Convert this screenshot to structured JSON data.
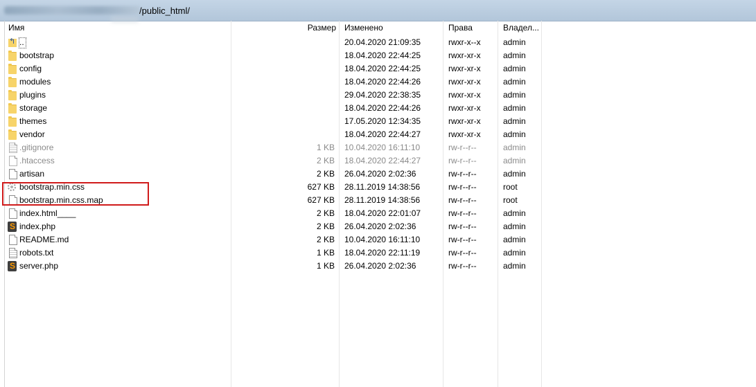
{
  "path": {
    "suffix": "/public_html/"
  },
  "columns": {
    "name": "Имя",
    "size": "Размер",
    "modified": "Изменено",
    "permissions": "Права",
    "owner": "Владел..."
  },
  "files": [
    {
      "name": "..",
      "icon": "parent-folder-icon",
      "size": "",
      "modified": "20.04.2020 21:09:35",
      "permissions": "rwxr-x--x",
      "owner": "admin",
      "dim": false
    },
    {
      "name": "bootstrap",
      "icon": "folder-icon",
      "size": "",
      "modified": "18.04.2020 22:44:25",
      "permissions": "rwxr-xr-x",
      "owner": "admin",
      "dim": false
    },
    {
      "name": "config",
      "icon": "folder-icon",
      "size": "",
      "modified": "18.04.2020 22:44:25",
      "permissions": "rwxr-xr-x",
      "owner": "admin",
      "dim": false
    },
    {
      "name": "modules",
      "icon": "folder-icon",
      "size": "",
      "modified": "18.04.2020 22:44:26",
      "permissions": "rwxr-xr-x",
      "owner": "admin",
      "dim": false
    },
    {
      "name": "plugins",
      "icon": "folder-icon",
      "size": "",
      "modified": "29.04.2020 22:38:35",
      "permissions": "rwxr-xr-x",
      "owner": "admin",
      "dim": false
    },
    {
      "name": "storage",
      "icon": "folder-icon",
      "size": "",
      "modified": "18.04.2020 22:44:26",
      "permissions": "rwxr-xr-x",
      "owner": "admin",
      "dim": false
    },
    {
      "name": "themes",
      "icon": "folder-icon",
      "size": "",
      "modified": "17.05.2020 12:34:35",
      "permissions": "rwxr-xr-x",
      "owner": "admin",
      "dim": false
    },
    {
      "name": "vendor",
      "icon": "folder-icon",
      "size": "",
      "modified": "18.04.2020 22:44:27",
      "permissions": "rwxr-xr-x",
      "owner": "admin",
      "dim": false
    },
    {
      "name": ".gitignore",
      "icon": "text-file-icon",
      "size": "1 KB",
      "modified": "10.04.2020 16:11:10",
      "permissions": "rw-r--r--",
      "owner": "admin",
      "dim": true
    },
    {
      "name": ".htaccess",
      "icon": "file-icon",
      "size": "2 KB",
      "modified": "18.04.2020 22:44:27",
      "permissions": "rw-r--r--",
      "owner": "admin",
      "dim": true
    },
    {
      "name": "artisan",
      "icon": "file-icon",
      "size": "2 KB",
      "modified": "26.04.2020 2:02:36",
      "permissions": "rw-r--r--",
      "owner": "admin",
      "dim": false
    },
    {
      "name": "bootstrap.min.css",
      "icon": "gear-file-icon",
      "size": "627 KB",
      "modified": "28.11.2019 14:38:56",
      "permissions": "rw-r--r--",
      "owner": "root",
      "dim": false
    },
    {
      "name": "bootstrap.min.css.map",
      "icon": "file-icon",
      "size": "627 KB",
      "modified": "28.11.2019 14:38:56",
      "permissions": "rw-r--r--",
      "owner": "root",
      "dim": false
    },
    {
      "name": "index.html____",
      "icon": "file-icon",
      "size": "2 KB",
      "modified": "18.04.2020 22:01:07",
      "permissions": "rw-r--r--",
      "owner": "admin",
      "dim": false
    },
    {
      "name": "index.php",
      "icon": "sublime-icon",
      "size": "2 KB",
      "modified": "26.04.2020 2:02:36",
      "permissions": "rw-r--r--",
      "owner": "admin",
      "dim": false
    },
    {
      "name": "README.md",
      "icon": "file-icon",
      "size": "2 KB",
      "modified": "10.04.2020 16:11:10",
      "permissions": "rw-r--r--",
      "owner": "admin",
      "dim": false
    },
    {
      "name": "robots.txt",
      "icon": "text-file-icon",
      "size": "1 KB",
      "modified": "18.04.2020 22:11:19",
      "permissions": "rw-r--r--",
      "owner": "admin",
      "dim": false
    },
    {
      "name": "server.php",
      "icon": "sublime-icon",
      "size": "1 KB",
      "modified": "26.04.2020 2:02:36",
      "permissions": "rw-r--r--",
      "owner": "admin",
      "dim": false
    }
  ],
  "highlight": {
    "color": "#d01a1a"
  }
}
